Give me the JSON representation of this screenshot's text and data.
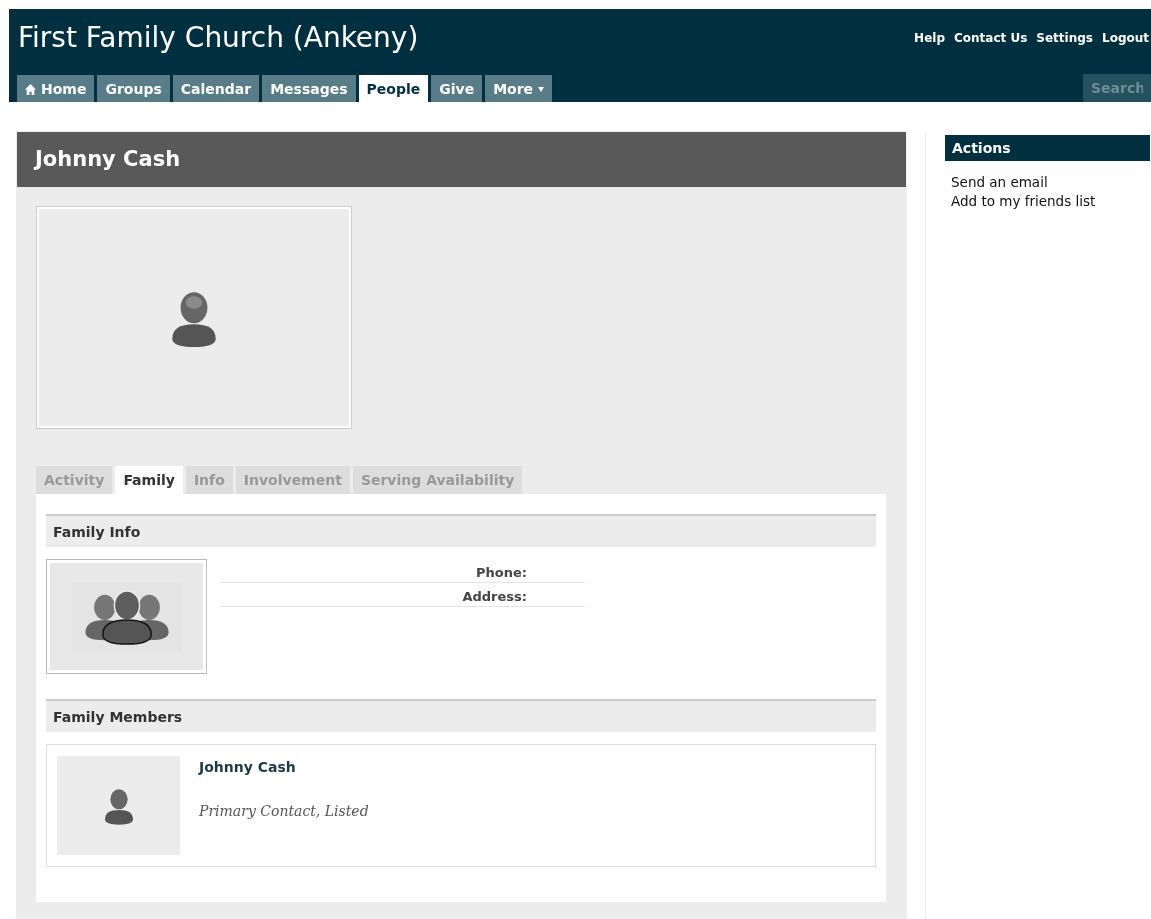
{
  "site_title": "First Family Church (Ankeny)",
  "top_links": [
    "Help",
    "Contact Us",
    "Settings",
    "Logout"
  ],
  "nav": [
    {
      "label": "Home",
      "kind": "home",
      "selected": false
    },
    {
      "label": "Groups",
      "kind": "plain",
      "selected": false
    },
    {
      "label": "Calendar",
      "kind": "plain",
      "selected": false
    },
    {
      "label": "Messages",
      "kind": "plain",
      "selected": false
    },
    {
      "label": "People",
      "kind": "plain",
      "selected": true
    },
    {
      "label": "Give",
      "kind": "plain",
      "selected": false
    },
    {
      "label": "More",
      "kind": "menu",
      "selected": false
    }
  ],
  "search": {
    "placeholder": "Search"
  },
  "profile": {
    "name": "Johnny Cash",
    "tabs": [
      {
        "label": "Activity",
        "selected": false
      },
      {
        "label": "Family",
        "selected": true
      },
      {
        "label": "Info",
        "selected": false
      },
      {
        "label": "Involvement",
        "selected": false
      },
      {
        "label": "Serving Availability",
        "selected": false
      }
    ],
    "family_info": {
      "heading": "Family Info",
      "fields": [
        {
          "label": "Phone:"
        },
        {
          "label": "Address:"
        }
      ]
    },
    "family_members": {
      "heading": "Family Members",
      "members": [
        {
          "name": "Johnny Cash",
          "role": "Primary Contact, Listed"
        }
      ]
    }
  },
  "actions": {
    "heading": "Actions",
    "links": [
      "Send an email",
      "Add to my friends list"
    ]
  }
}
